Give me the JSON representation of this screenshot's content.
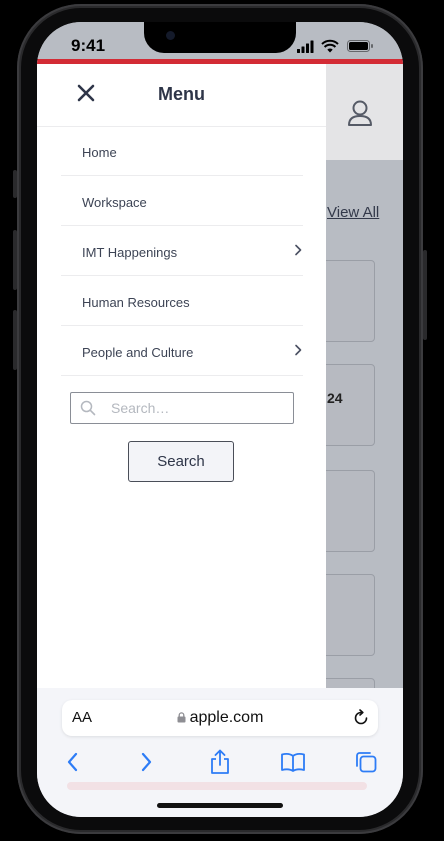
{
  "status_bar": {
    "time": "9:41"
  },
  "colors": {
    "accent": "#d32b35",
    "ios_blue": "#2d7cf6",
    "title": "#2e3548"
  },
  "background_page": {
    "view_all_label": "View All",
    "card_text": "24",
    "user_icon": "user-icon"
  },
  "drawer": {
    "title": "Menu",
    "close_icon": "close-icon",
    "items": [
      {
        "label": "Home",
        "has_submenu": false
      },
      {
        "label": "Workspace",
        "has_submenu": false
      },
      {
        "label": "IMT Happenings",
        "has_submenu": true
      },
      {
        "label": "Human Resources",
        "has_submenu": false
      },
      {
        "label": "People and Culture",
        "has_submenu": true
      }
    ],
    "search": {
      "placeholder": "Search…",
      "value": "",
      "button_label": "Search"
    }
  },
  "safari": {
    "aa_label": "AA",
    "url": "apple.com",
    "toolbar_icons": [
      "back-icon",
      "forward-icon",
      "share-icon",
      "bookmarks-icon",
      "tabs-icon"
    ]
  }
}
